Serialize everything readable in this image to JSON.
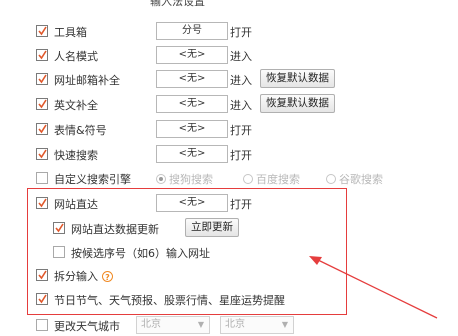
{
  "header": {
    "title": "输入法设置"
  },
  "colors": {
    "checkbox_tick": "#e0582b",
    "highlight_border": "#e53d3d",
    "arrow": "#e53d3d",
    "help_icon": "#f08a24"
  },
  "rows": [
    {
      "label": "工具箱",
      "checked": true,
      "hotkey": "分号",
      "action": "打开"
    },
    {
      "label": "人名模式",
      "checked": true,
      "hotkey": "<无>",
      "action": "进入"
    },
    {
      "label": "网址邮箱补全",
      "checked": true,
      "hotkey": "<无>",
      "action": "进入",
      "button": "恢复默认数据"
    },
    {
      "label": "英文补全",
      "checked": true,
      "hotkey": "<无>",
      "action": "进入",
      "button": "恢复默认数据"
    },
    {
      "label": "表情&符号",
      "checked": true,
      "hotkey": "<无>",
      "action": "打开"
    },
    {
      "label": "快速搜索",
      "checked": true,
      "hotkey": "<无>",
      "action": "打开"
    }
  ],
  "search_engine": {
    "label": "自定义搜索引擎",
    "checked": false,
    "options": [
      {
        "label": "搜狗搜索",
        "selected": true
      },
      {
        "label": "百度搜索",
        "selected": false
      },
      {
        "label": "谷歌搜索",
        "selected": false
      }
    ]
  },
  "direct_site": {
    "label": "网站直达",
    "checked": true,
    "hotkey": "<无>",
    "action": "打开"
  },
  "direct_site_update": {
    "label": "网站直达数据更新",
    "checked": true,
    "button": "立即更新"
  },
  "candidate_url": {
    "label": "按候选序号（如6）输入网址",
    "checked": false
  },
  "split_input": {
    "label": "拆分输入",
    "checked": true,
    "help": "?"
  },
  "festival": {
    "label": "节日节气、天气预报、股票行情、星座运势提醒",
    "checked": true
  },
  "weather_city": {
    "label": "更改天气城市",
    "checked": false,
    "province": "北京",
    "city": "北京"
  }
}
